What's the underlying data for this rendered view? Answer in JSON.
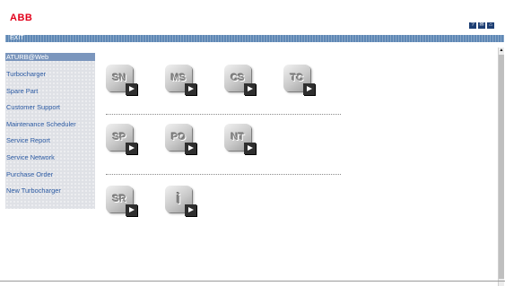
{
  "brand": {
    "logo_text": "ABB"
  },
  "top_icons": [
    {
      "icon": "help-icon",
      "glyph": "?"
    },
    {
      "icon": "mail-icon",
      "glyph": "✉"
    },
    {
      "icon": "home-icon",
      "glyph": "⌂"
    }
  ],
  "header_bar": {
    "exit_label": "EXIT"
  },
  "sidebar": {
    "items": [
      {
        "label": "ATURB@Web",
        "active": true
      },
      {
        "label": "Turbocharger"
      },
      {
        "label": "Spare Part"
      },
      {
        "label": "Customer Support"
      },
      {
        "label": "Maintenance Scheduler"
      },
      {
        "label": "Service Report"
      },
      {
        "label": "Service Network"
      },
      {
        "label": "Purchase Order"
      },
      {
        "label": "New Turbocharger"
      }
    ]
  },
  "tiles": {
    "row1": [
      {
        "label": "SN"
      },
      {
        "label": "MS"
      },
      {
        "label": "CS"
      },
      {
        "label": "TC"
      }
    ],
    "row2": [
      {
        "label": "SP"
      },
      {
        "label": "PO"
      },
      {
        "label": "NT"
      }
    ],
    "row3": [
      {
        "label": "SR"
      },
      {
        "label": "i"
      }
    ]
  },
  "colors": {
    "logo_red": "#e2001a",
    "header_bar_blue": "#5f88b5",
    "sidebar_link": "#2b5aa3",
    "sidebar_active_bg": "#7b96bd"
  }
}
